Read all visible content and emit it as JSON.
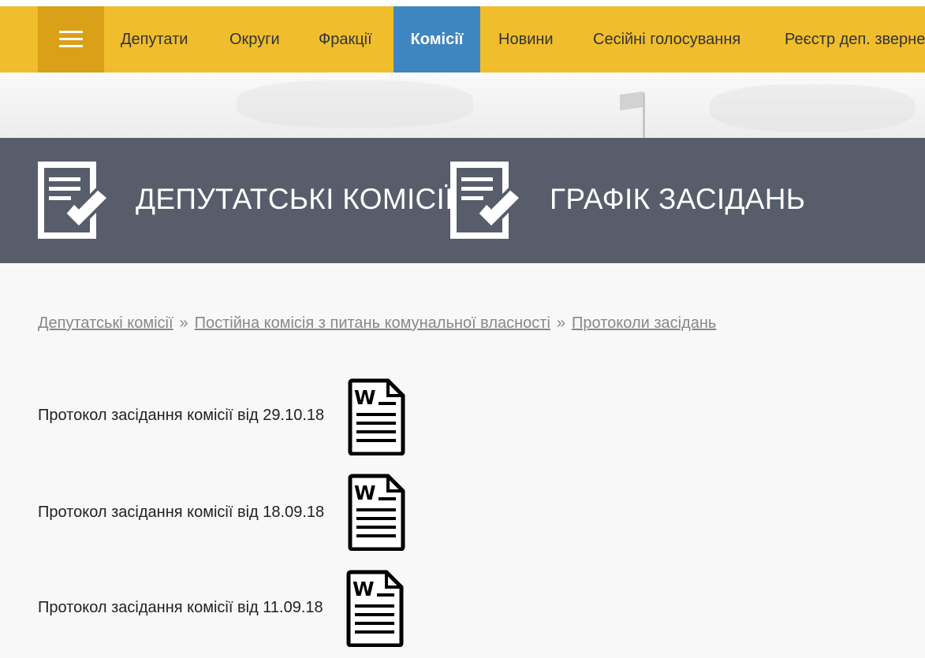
{
  "nav": {
    "items": [
      {
        "label": "Депутати"
      },
      {
        "label": "Округи"
      },
      {
        "label": "Фракції"
      },
      {
        "label": "Комісії",
        "active": true
      },
      {
        "label": "Новини"
      },
      {
        "label": "Сесійні голосування"
      },
      {
        "label": "Реєстр деп. звернень"
      }
    ]
  },
  "banner": {
    "link1": "ДЕПУТАТСЬКІ КОМІСІЇ",
    "link2": "ГРАФІК ЗАСІДАНЬ"
  },
  "breadcrumb": {
    "items": [
      "Депутатські комісії",
      "Постійна комісія з питань комунальної власності",
      "Протоколи засідань"
    ],
    "separator": "»"
  },
  "documents": [
    {
      "label": "Протокол засідання комісії від 29.10.18",
      "icon": "word-document-icon"
    },
    {
      "label": "Протокол засідання комісії від 18.09.18",
      "icon": "word-document-icon"
    },
    {
      "label": "Протокол засідання комісії від 11.09.18",
      "icon": "word-document-icon"
    }
  ],
  "colors": {
    "nav_bg": "#f0bd2d",
    "nav_burger_bg": "#d9a018",
    "nav_active_bg": "#3f86c0",
    "banner_bg": "#575d6a",
    "page_bg": "#f8f8f8"
  }
}
